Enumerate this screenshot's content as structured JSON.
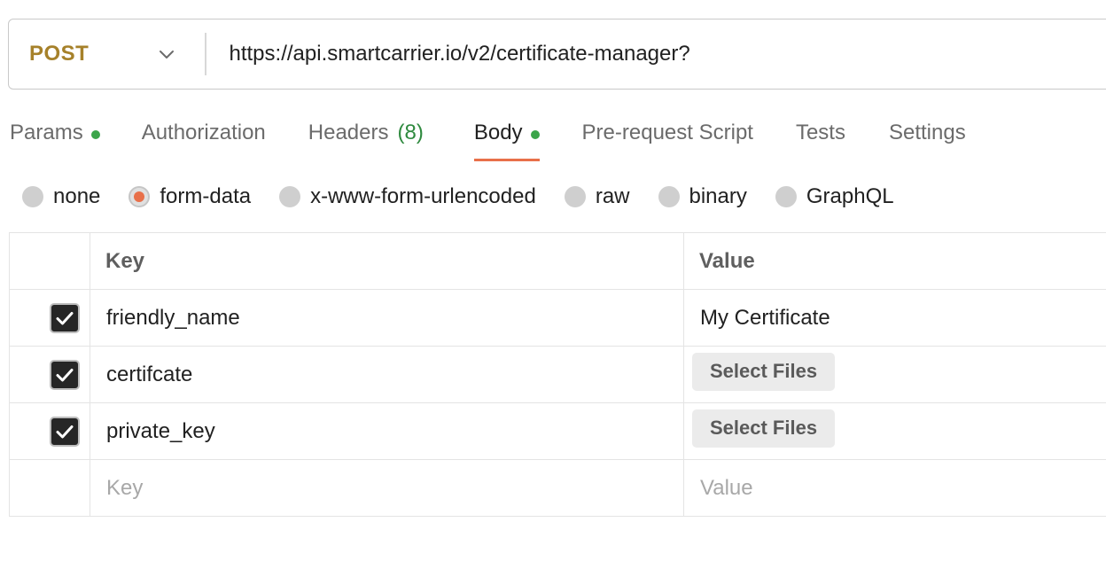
{
  "request": {
    "method": "POST",
    "url": "https://api.smartcarrier.io/v2/certificate-manager?"
  },
  "tabs": [
    {
      "label": "Params",
      "dot": true
    },
    {
      "label": "Authorization"
    },
    {
      "label": "Headers",
      "count": "(8)"
    },
    {
      "label": "Body",
      "dot": true,
      "active": true
    },
    {
      "label": "Pre-request Script"
    },
    {
      "label": "Tests"
    },
    {
      "label": "Settings"
    }
  ],
  "body_types": [
    {
      "label": "none"
    },
    {
      "label": "form-data",
      "selected": true
    },
    {
      "label": "x-www-form-urlencoded"
    },
    {
      "label": "raw"
    },
    {
      "label": "binary"
    },
    {
      "label": "GraphQL"
    }
  ],
  "table": {
    "headers": {
      "key": "Key",
      "value": "Value"
    },
    "rows": [
      {
        "checked": true,
        "key": "friendly_name",
        "value": "My Certificate"
      },
      {
        "checked": true,
        "key": "certifcate",
        "value_button": "Select Files"
      },
      {
        "checked": true,
        "key": "private_key",
        "value_button": "Select Files"
      }
    ],
    "new_row": {
      "key_placeholder": "Key",
      "value_placeholder": "Value"
    }
  },
  "colors": {
    "method": "#a6812a",
    "active_tab_underline": "#e8704a",
    "dot": "#3ba54a",
    "headers_count": "#2f8a3f",
    "radio_selected": "#e8704a"
  }
}
